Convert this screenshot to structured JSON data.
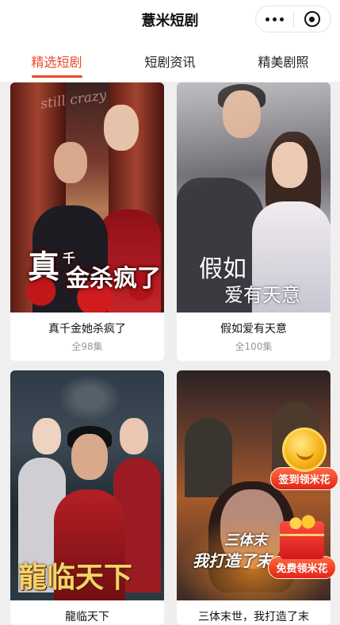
{
  "header": {
    "title": "薏米短剧"
  },
  "tabs": [
    {
      "label": "精选短剧",
      "active": true
    },
    {
      "label": "短剧资讯",
      "active": false
    },
    {
      "label": "精美剧照",
      "active": false
    }
  ],
  "dramas": [
    {
      "name": "真千金她杀疯了",
      "episodes": "全98集",
      "poster_text_main": "真",
      "poster_text_small": "千",
      "poster_text_rest": "金杀疯了",
      "poster_script": "still crazy"
    },
    {
      "name": "假如爱有天意",
      "episodes": "全100集",
      "poster_text_line1": "假如",
      "poster_text_line2": "爱有天意"
    },
    {
      "name": "龍临天下",
      "poster_text": "龍临天下"
    },
    {
      "name": "三体末世，我打造了末",
      "poster_text_line1": "三体末",
      "poster_text_line2": "我打造了末"
    }
  ],
  "floating": {
    "checkin": "签到领米花",
    "free": "免费领米花"
  },
  "colors": {
    "accent": "#e8492f",
    "badge_red": "#e2241c",
    "coin_gold": "#f6b519"
  }
}
